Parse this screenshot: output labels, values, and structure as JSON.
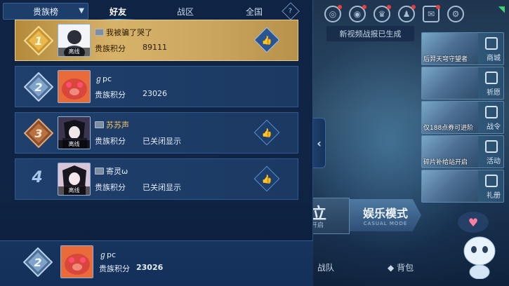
{
  "header": {
    "dropdown_label": "贵族榜",
    "tabs": [
      {
        "label": "好友",
        "active": true
      },
      {
        "label": "战区",
        "active": false
      },
      {
        "label": "全国",
        "active": false
      }
    ],
    "help_symbol": "?"
  },
  "rows": [
    {
      "rank": "1",
      "name": "我被骗了哭了",
      "score_label": "贵族积分",
      "score": "89111",
      "status": "离线",
      "name_color": "dark"
    },
    {
      "rank": "2",
      "name": "ℊpc",
      "score_label": "贵族积分",
      "score": "23026",
      "status": "",
      "name_color": "normal"
    },
    {
      "rank": "3",
      "name": "苏苏声",
      "score_label": "贵族积分",
      "score": "已关闭显示",
      "status": "离线",
      "name_color": "gold"
    },
    {
      "rank": "4",
      "name": "寄灵ω",
      "score_label": "贵族积分",
      "score": "已关闭显示",
      "status": "离线",
      "name_color": "normal"
    }
  ],
  "self": {
    "rank": "2",
    "name": "ℊpc",
    "score_label": "贵族积分",
    "score": "23026"
  },
  "background": {
    "toast": "新视频战报已生成",
    "side_menu": [
      {
        "caption": "后羿天穹守望者",
        "label": "商城"
      },
      {
        "caption": "",
        "label": "祈愿"
      },
      {
        "caption": "仅188点券可进阶",
        "label": "战令"
      },
      {
        "caption": "碎片补给站开启",
        "label": "活动"
      },
      {
        "caption": "",
        "label": "礼册"
      }
    ],
    "mode_left": {
      "big": "立",
      "small": "开启"
    },
    "mode_button": {
      "title": "娱乐模式",
      "subtitle": "CASUAL MODE"
    },
    "bottom_tabs": [
      "战队",
      "背包"
    ]
  },
  "colors": {
    "panel_bg": "#0f2345",
    "row_bg": "#1f3f6c",
    "first_row_gold": "#d7b36a",
    "accent_blue": "#4fb2ff",
    "gold_name": "#f2c266"
  },
  "icons": [
    "chevron-down-icon",
    "help-icon",
    "like-icon",
    "noble-badge-icon",
    "collapse-arrow-icon",
    "settings-icon",
    "mail-icon",
    "friends-icon",
    "trophy-icon",
    "wifi-icon"
  ]
}
